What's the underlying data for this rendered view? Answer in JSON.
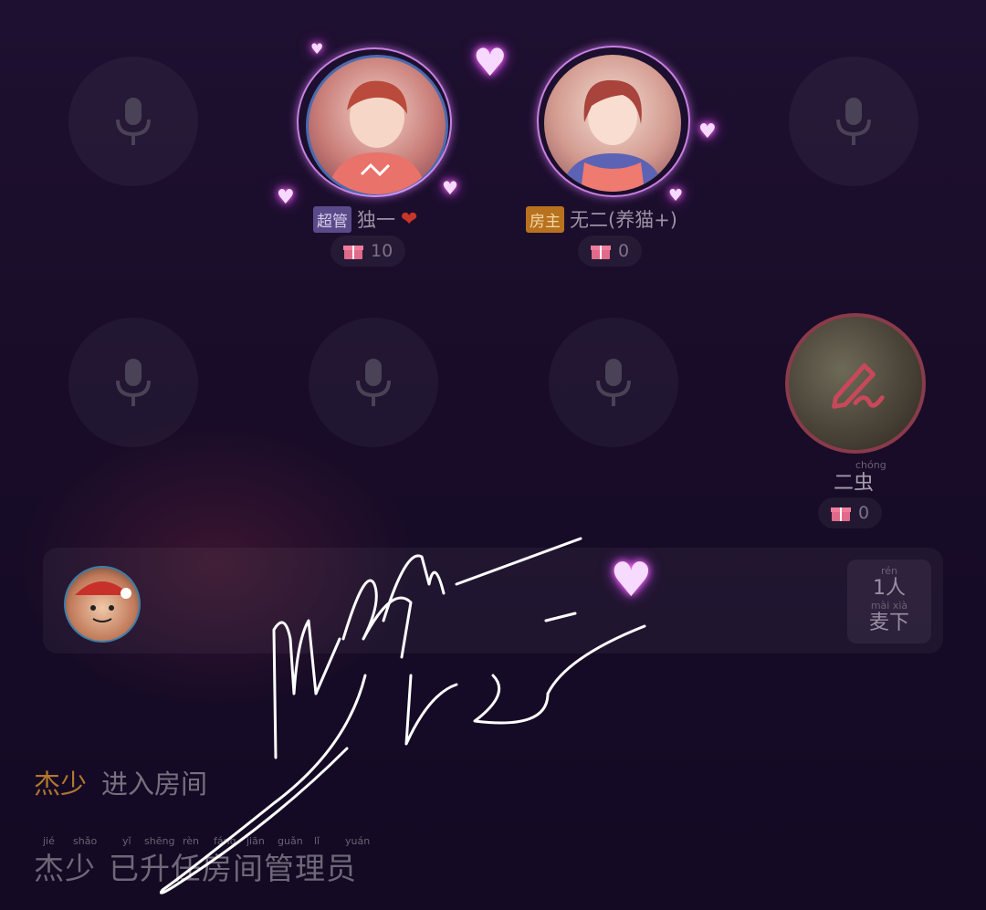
{
  "seats": {
    "host_left": {
      "badge": "超管",
      "name": "独一",
      "heart": "❤",
      "gift_count": "10"
    },
    "host_right": {
      "badge": "房主",
      "name": "无二(养猫+)",
      "gift_count": "0"
    },
    "seat_right": {
      "name": "二虫",
      "name_pinyin": "chóng",
      "gift_count": "0"
    }
  },
  "panel": {
    "count_label": "1人",
    "count_pinyin": "rén",
    "leave_label": "麦下",
    "leave_pinyin": "mài xià"
  },
  "chat": [
    {
      "user": "杰少",
      "text": "进入房间"
    },
    {
      "user": "杰少",
      "text": "已升任房间管理员",
      "pinyin": [
        "jié",
        "shǎo",
        "yǐ",
        "shēng",
        "rèn",
        "fáng",
        "jiān",
        "guǎn",
        "lǐ",
        "yuán"
      ]
    }
  ],
  "icons": {
    "empty_seat": "microphone-icon",
    "gift": "gift-icon",
    "edit": "pen-icon"
  },
  "colors": {
    "accent_gold": "#b2792e",
    "glow_pink": "#e896ff",
    "admin_badge": "#5a4a8a",
    "owner_badge": "#b8721e"
  }
}
